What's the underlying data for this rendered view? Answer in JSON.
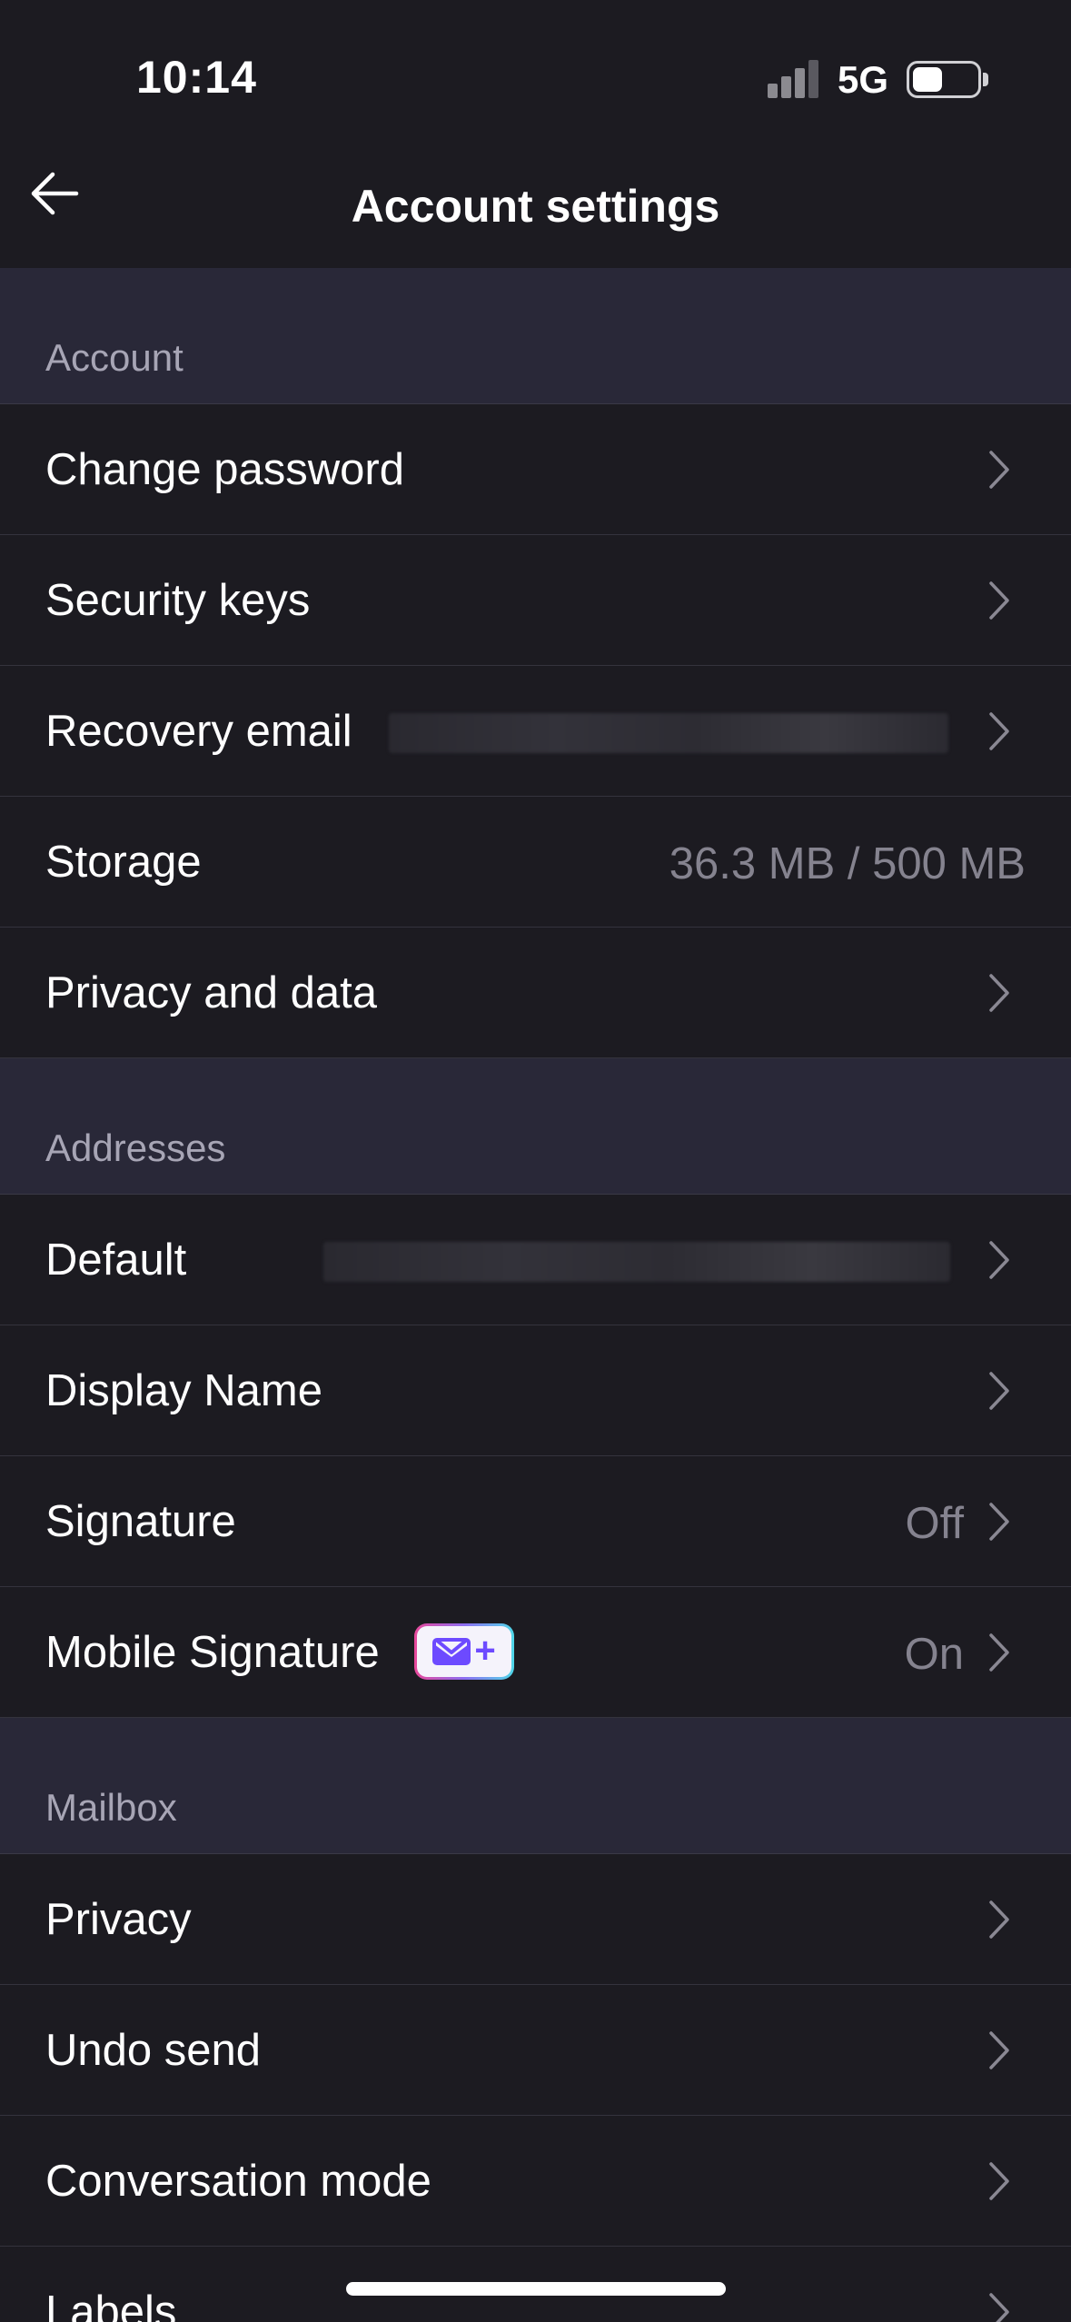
{
  "status_bar": {
    "time": "10:14",
    "network": "5G"
  },
  "nav": {
    "title": "Account settings"
  },
  "sections": {
    "account": {
      "header": "Account",
      "change_password": "Change password",
      "security_keys": "Security keys",
      "recovery_email": "Recovery email",
      "storage": "Storage",
      "storage_value": "36.3 MB / 500 MB",
      "privacy_and_data": "Privacy and data"
    },
    "addresses": {
      "header": "Addresses",
      "default": "Default",
      "display_name": "Display Name",
      "signature": "Signature",
      "signature_value": "Off",
      "mobile_signature": "Mobile Signature",
      "mobile_signature_value": "On"
    },
    "mailbox": {
      "header": "Mailbox",
      "privacy": "Privacy",
      "undo_send": "Undo send",
      "conversation_mode": "Conversation mode",
      "labels": "Labels"
    }
  },
  "colors": {
    "background": "#1c1b21",
    "section_header": "#292838",
    "accent": "#6d4aff",
    "secondary_text": "#85838f"
  },
  "icons": [
    "back-arrow-icon",
    "chevron-right-icon",
    "mail-plus-icon",
    "signal-icon",
    "battery-icon"
  ]
}
